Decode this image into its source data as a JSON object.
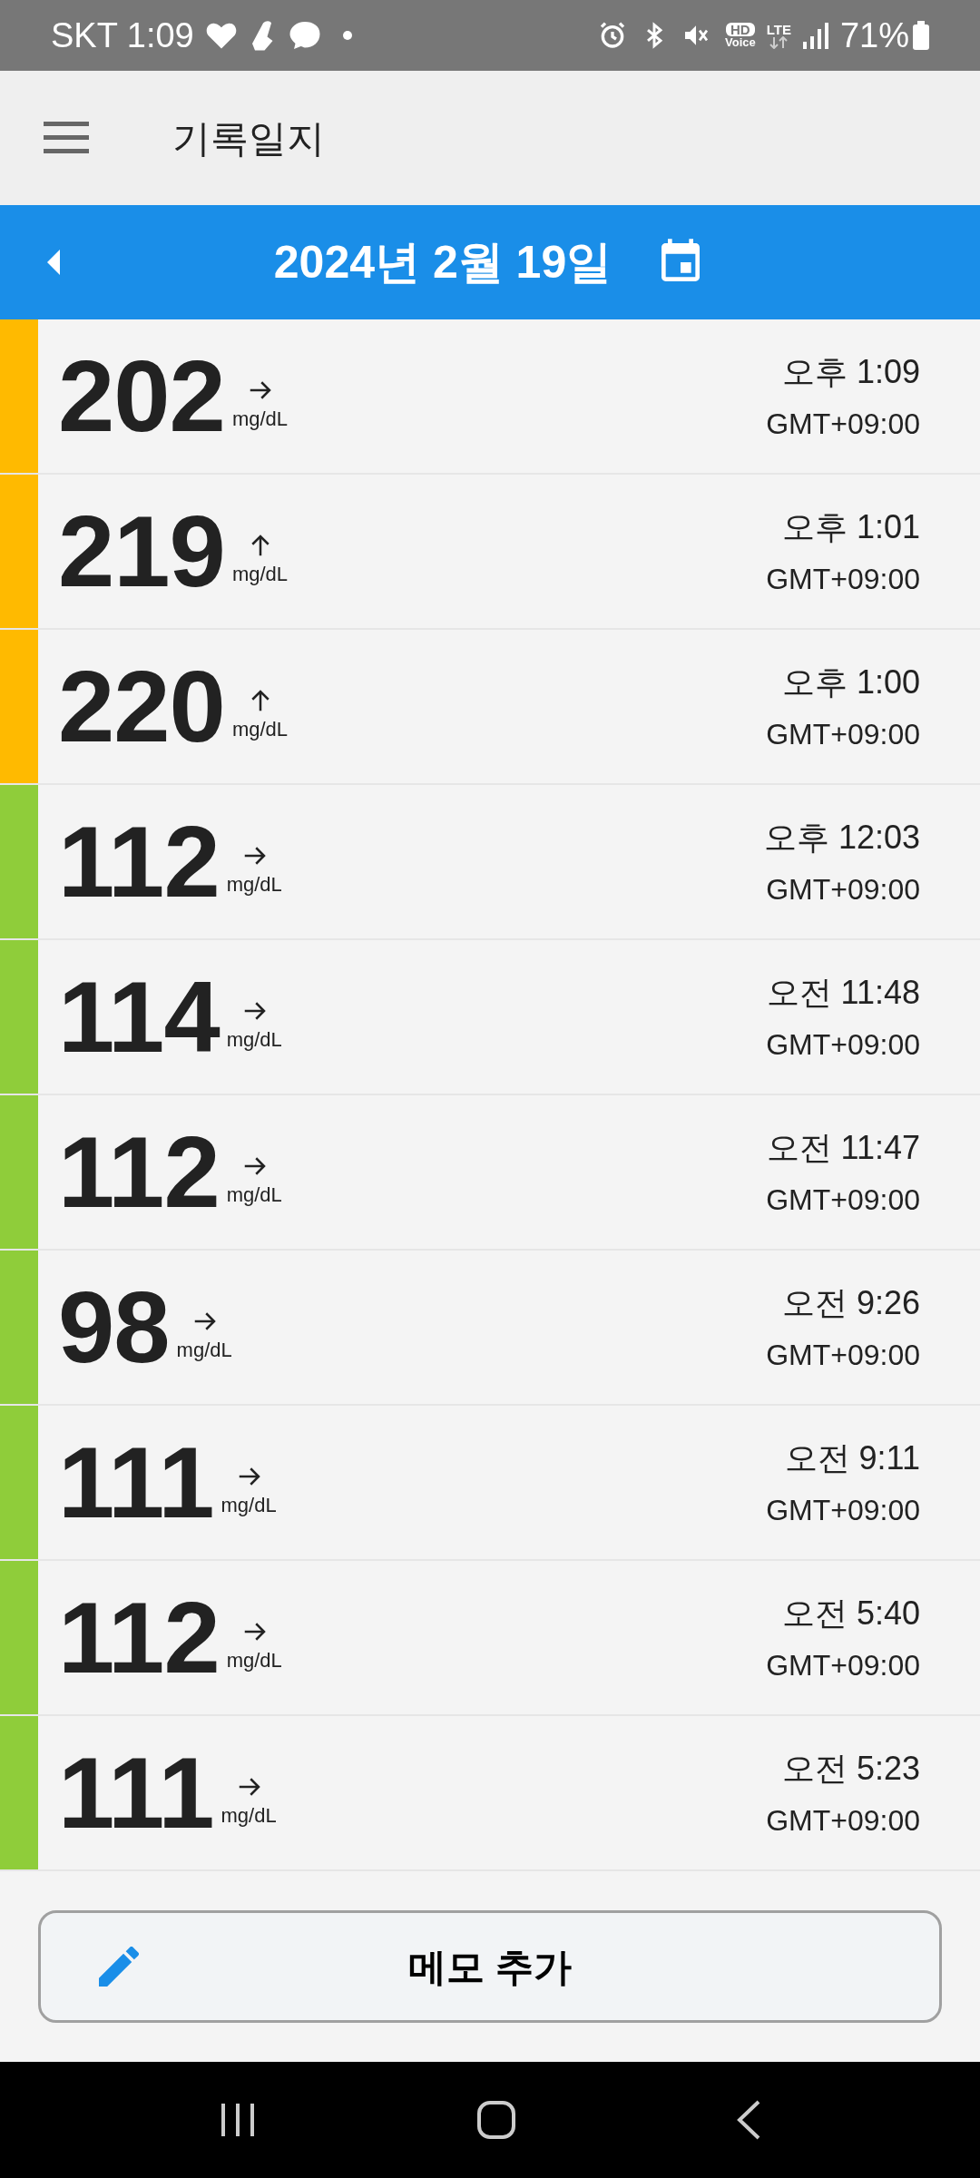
{
  "status_bar": {
    "carrier_time": "SKT 1:09",
    "hd_label": "HD",
    "voice_label": "Voice",
    "lte_label": "LTE",
    "battery": "71%"
  },
  "app_bar": {
    "title": "기록일지"
  },
  "date_bar": {
    "date": "2024년 2월 19일"
  },
  "readings": [
    {
      "value": "202",
      "unit": "mg/dL",
      "kind": "flat",
      "time": "오후 1:09",
      "timezone": "GMT+09:00",
      "color": "#ffba00"
    },
    {
      "value": "219",
      "unit": "mg/dL",
      "kind": "up",
      "time": "오후 1:01",
      "timezone": "GMT+09:00",
      "color": "#ffba00"
    },
    {
      "value": "220",
      "unit": "mg/dL",
      "kind": "up",
      "time": "오후 1:00",
      "timezone": "GMT+09:00",
      "color": "#ffba00"
    },
    {
      "value": "112",
      "unit": "mg/dL",
      "kind": "flat",
      "time": "오후 12:03",
      "timezone": "GMT+09:00",
      "color": "#8fcd3a"
    },
    {
      "value": "114",
      "unit": "mg/dL",
      "kind": "flat",
      "time": "오전 11:48",
      "timezone": "GMT+09:00",
      "color": "#8fcd3a"
    },
    {
      "value": "112",
      "unit": "mg/dL",
      "kind": "flat",
      "time": "오전 11:47",
      "timezone": "GMT+09:00",
      "color": "#8fcd3a"
    },
    {
      "value": "98",
      "unit": "mg/dL",
      "kind": "flat",
      "time": "오전 9:26",
      "timezone": "GMT+09:00",
      "color": "#8fcd3a"
    },
    {
      "value": "111",
      "unit": "mg/dL",
      "kind": "flat",
      "time": "오전 9:11",
      "timezone": "GMT+09:00",
      "color": "#8fcd3a"
    },
    {
      "value": "112",
      "unit": "mg/dL",
      "kind": "flat",
      "time": "오전 5:40",
      "timezone": "GMT+09:00",
      "color": "#8fcd3a"
    },
    {
      "value": "111",
      "unit": "mg/dL",
      "kind": "flat",
      "time": "오전 5:23",
      "timezone": "GMT+09:00",
      "color": "#8fcd3a"
    }
  ],
  "add_note_button": {
    "label": "메모 추가"
  }
}
